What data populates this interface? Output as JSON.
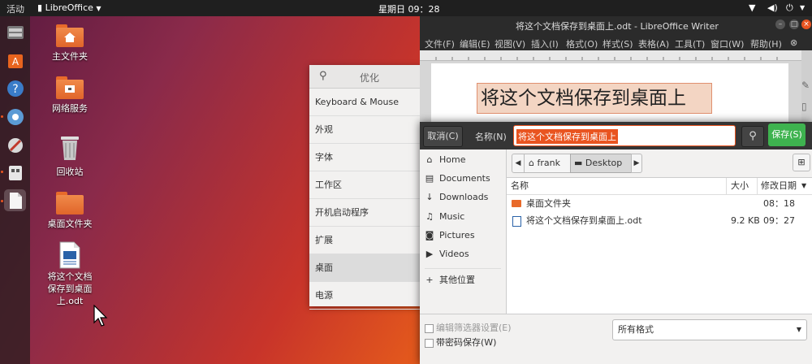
{
  "topbar": {
    "activities": "活动",
    "app_name": "LibreOffice",
    "clock": "星期日 09：28"
  },
  "desktop": {
    "icons": [
      {
        "label": "主文件夹"
      },
      {
        "label": "网络服务"
      },
      {
        "label": "回收站"
      },
      {
        "label": "桌面文件夹"
      },
      {
        "label_lines": [
          "将这个文档",
          "保存到桌面",
          "上.odt"
        ]
      }
    ]
  },
  "tweaks": {
    "title": "优化",
    "items": [
      "Keyboard & Mouse",
      "外观",
      "字体",
      "工作区",
      "开机启动程序",
      "扩展",
      "桌面",
      "电源"
    ],
    "selected": "桌面"
  },
  "writer": {
    "title": "将这个文档保存到桌面上.odt - LibreOffice Writer",
    "menu": [
      "文件(F)",
      "编辑(E)",
      "视图(V)",
      "插入(I)",
      "格式(O)",
      "样式(S)",
      "表格(A)",
      "工具(T)",
      "窗口(W)",
      "帮助(H)"
    ],
    "document_text": "将这个文档保存到桌面上"
  },
  "save_dialog": {
    "cancel": "取消(C)",
    "name_label": "名称(N)",
    "name_value": "将这个文档保存到桌面上",
    "save": "保存(S)",
    "places": [
      {
        "icon": "⌂",
        "label": "Home"
      },
      {
        "icon": "▤",
        "label": "Documents"
      },
      {
        "icon": "↓",
        "label": "Downloads"
      },
      {
        "icon": "♫",
        "label": "Music"
      },
      {
        "icon": "◙",
        "label": "Pictures"
      },
      {
        "icon": "▶",
        "label": "Videos"
      },
      {
        "icon": "+",
        "label": "其他位置"
      }
    ],
    "path": [
      "frank",
      "Desktop"
    ],
    "columns": {
      "name": "名称",
      "size": "大小",
      "modified": "修改日期"
    },
    "files": [
      {
        "name": "桌面文件夹",
        "size": "",
        "modified": "08：18",
        "type": "folder"
      },
      {
        "name": "将这个文档保存到桌面上.odt",
        "size": "9.2 KB",
        "modified": "09：27",
        "type": "document"
      }
    ],
    "edit_filter": "编辑筛选器设置(E)",
    "password_save": "带密码保存(W)",
    "filetype": "所有格式"
  },
  "colors": {
    "accent": "#e95420",
    "save_button": "#3eb34f",
    "selection": "#e95420"
  }
}
